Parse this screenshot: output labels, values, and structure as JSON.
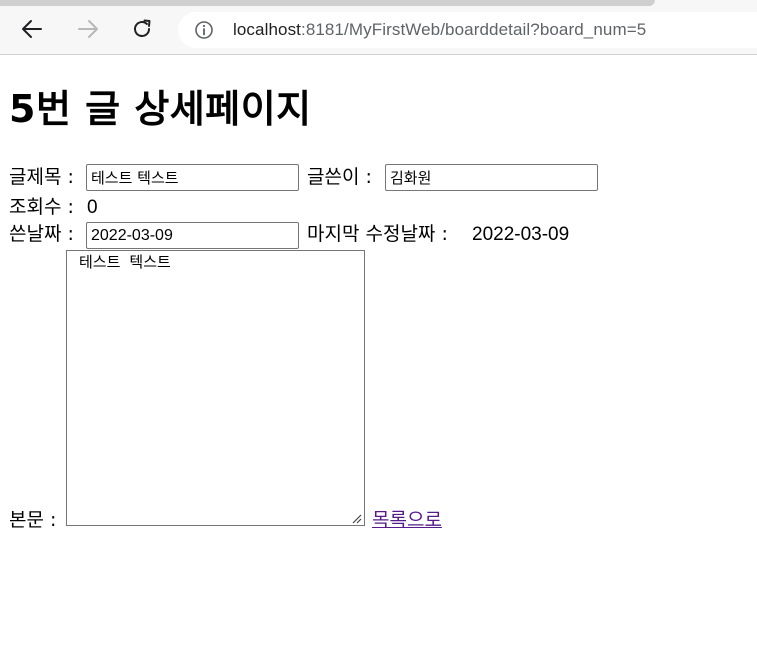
{
  "browser": {
    "url_host": "localhost",
    "url_rest": ":8181/MyFirstWeb/boarddetail?board_num=5",
    "back_icon": "arrow-left-icon",
    "forward_icon": "arrow-right-icon",
    "reload_icon": "reload-icon",
    "info_icon": "info-icon"
  },
  "page": {
    "title": "5번 글 상세페이지",
    "title_label": "글제목 :",
    "title_value": "테스트 텍스트",
    "writer_label": "글쓴이 :",
    "writer_value": "김화원",
    "hit_label": "조회수 :",
    "hit_value": "0",
    "date_label": "쓴날짜 :",
    "date_value": "2022-03-09",
    "modified_label": "마지막 수정날짜 :",
    "modified_value": "2022-03-09",
    "content_label": "본문 :",
    "content_value": "테스트 텍스트",
    "list_link": "목록으로",
    "link_color": "#551a8b"
  }
}
